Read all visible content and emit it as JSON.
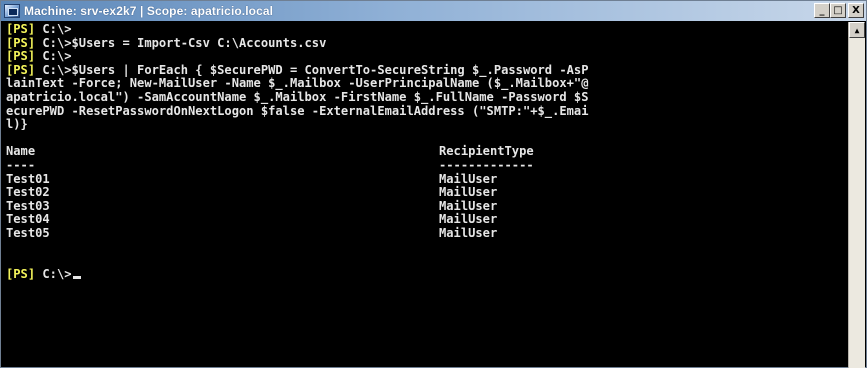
{
  "window": {
    "title": "Machine: srv-ex2k7 | Scope: apatricio.local",
    "minimize_glyph": "_",
    "maximize_glyph": "□",
    "close_glyph": "X",
    "icon": "powershell-console-icon"
  },
  "console": {
    "prompt_tag": "[PS]",
    "lines": [
      {
        "tag": "[PS]",
        "text": " C:\\>"
      },
      {
        "tag": "[PS]",
        "text": " C:\\>$Users = Import-Csv C:\\Accounts.csv"
      },
      {
        "tag": "[PS]",
        "text": " C:\\>"
      },
      {
        "tag": "[PS]",
        "text": " C:\\>$Users | ForEach { $SecurePWD = ConvertTo-SecureString $_.Password -AsP"
      },
      {
        "tag": "",
        "text": "lainText -Force; New-MailUser -Name $_.Mailbox -UserPrincipalName ($_.Mailbox+\"@"
      },
      {
        "tag": "",
        "text": "apatricio.local\") -SamAccountName $_.Mailbox -FirstName $_.FullName -Password $S"
      },
      {
        "tag": "",
        "text": "ecurePWD -ResetPasswordOnNextLogon $false -ExternalEmailAddress (\"SMTP:\"+$_.Emai"
      },
      {
        "tag": "",
        "text": "l)}"
      }
    ],
    "table": {
      "headers": [
        "Name",
        "RecipientType"
      ],
      "underlines": [
        "----",
        "-------------"
      ],
      "rows": [
        [
          "Test01",
          "MailUser"
        ],
        [
          "Test02",
          "MailUser"
        ],
        [
          "Test03",
          "MailUser"
        ],
        [
          "Test04",
          "MailUser"
        ],
        [
          "Test05",
          "MailUser"
        ]
      ]
    },
    "final_prompt": {
      "tag": "[PS]",
      "text": " C:\\>"
    }
  },
  "scrollbar": {
    "up_glyph": "▲"
  },
  "colors": {
    "background": "#000000",
    "text": "#e6e6e6",
    "prompt_tag": "#f3f35a"
  }
}
